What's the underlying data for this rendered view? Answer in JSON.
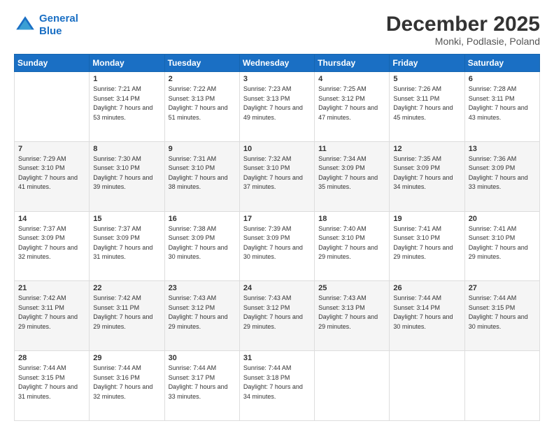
{
  "logo": {
    "line1": "General",
    "line2": "Blue"
  },
  "header": {
    "month": "December 2025",
    "location": "Monki, Podlasie, Poland"
  },
  "days_of_week": [
    "Sunday",
    "Monday",
    "Tuesday",
    "Wednesday",
    "Thursday",
    "Friday",
    "Saturday"
  ],
  "weeks": [
    [
      {
        "day": "",
        "sunrise": "",
        "sunset": "",
        "daylight": ""
      },
      {
        "day": "1",
        "sunrise": "Sunrise: 7:21 AM",
        "sunset": "Sunset: 3:14 PM",
        "daylight": "Daylight: 7 hours and 53 minutes."
      },
      {
        "day": "2",
        "sunrise": "Sunrise: 7:22 AM",
        "sunset": "Sunset: 3:13 PM",
        "daylight": "Daylight: 7 hours and 51 minutes."
      },
      {
        "day": "3",
        "sunrise": "Sunrise: 7:23 AM",
        "sunset": "Sunset: 3:13 PM",
        "daylight": "Daylight: 7 hours and 49 minutes."
      },
      {
        "day": "4",
        "sunrise": "Sunrise: 7:25 AM",
        "sunset": "Sunset: 3:12 PM",
        "daylight": "Daylight: 7 hours and 47 minutes."
      },
      {
        "day": "5",
        "sunrise": "Sunrise: 7:26 AM",
        "sunset": "Sunset: 3:11 PM",
        "daylight": "Daylight: 7 hours and 45 minutes."
      },
      {
        "day": "6",
        "sunrise": "Sunrise: 7:28 AM",
        "sunset": "Sunset: 3:11 PM",
        "daylight": "Daylight: 7 hours and 43 minutes."
      }
    ],
    [
      {
        "day": "7",
        "sunrise": "Sunrise: 7:29 AM",
        "sunset": "Sunset: 3:10 PM",
        "daylight": "Daylight: 7 hours and 41 minutes."
      },
      {
        "day": "8",
        "sunrise": "Sunrise: 7:30 AM",
        "sunset": "Sunset: 3:10 PM",
        "daylight": "Daylight: 7 hours and 39 minutes."
      },
      {
        "day": "9",
        "sunrise": "Sunrise: 7:31 AM",
        "sunset": "Sunset: 3:10 PM",
        "daylight": "Daylight: 7 hours and 38 minutes."
      },
      {
        "day": "10",
        "sunrise": "Sunrise: 7:32 AM",
        "sunset": "Sunset: 3:10 PM",
        "daylight": "Daylight: 7 hours and 37 minutes."
      },
      {
        "day": "11",
        "sunrise": "Sunrise: 7:34 AM",
        "sunset": "Sunset: 3:09 PM",
        "daylight": "Daylight: 7 hours and 35 minutes."
      },
      {
        "day": "12",
        "sunrise": "Sunrise: 7:35 AM",
        "sunset": "Sunset: 3:09 PM",
        "daylight": "Daylight: 7 hours and 34 minutes."
      },
      {
        "day": "13",
        "sunrise": "Sunrise: 7:36 AM",
        "sunset": "Sunset: 3:09 PM",
        "daylight": "Daylight: 7 hours and 33 minutes."
      }
    ],
    [
      {
        "day": "14",
        "sunrise": "Sunrise: 7:37 AM",
        "sunset": "Sunset: 3:09 PM",
        "daylight": "Daylight: 7 hours and 32 minutes."
      },
      {
        "day": "15",
        "sunrise": "Sunrise: 7:37 AM",
        "sunset": "Sunset: 3:09 PM",
        "daylight": "Daylight: 7 hours and 31 minutes."
      },
      {
        "day": "16",
        "sunrise": "Sunrise: 7:38 AM",
        "sunset": "Sunset: 3:09 PM",
        "daylight": "Daylight: 7 hours and 30 minutes."
      },
      {
        "day": "17",
        "sunrise": "Sunrise: 7:39 AM",
        "sunset": "Sunset: 3:09 PM",
        "daylight": "Daylight: 7 hours and 30 minutes."
      },
      {
        "day": "18",
        "sunrise": "Sunrise: 7:40 AM",
        "sunset": "Sunset: 3:10 PM",
        "daylight": "Daylight: 7 hours and 29 minutes."
      },
      {
        "day": "19",
        "sunrise": "Sunrise: 7:41 AM",
        "sunset": "Sunset: 3:10 PM",
        "daylight": "Daylight: 7 hours and 29 minutes."
      },
      {
        "day": "20",
        "sunrise": "Sunrise: 7:41 AM",
        "sunset": "Sunset: 3:10 PM",
        "daylight": "Daylight: 7 hours and 29 minutes."
      }
    ],
    [
      {
        "day": "21",
        "sunrise": "Sunrise: 7:42 AM",
        "sunset": "Sunset: 3:11 PM",
        "daylight": "Daylight: 7 hours and 29 minutes."
      },
      {
        "day": "22",
        "sunrise": "Sunrise: 7:42 AM",
        "sunset": "Sunset: 3:11 PM",
        "daylight": "Daylight: 7 hours and 29 minutes."
      },
      {
        "day": "23",
        "sunrise": "Sunrise: 7:43 AM",
        "sunset": "Sunset: 3:12 PM",
        "daylight": "Daylight: 7 hours and 29 minutes."
      },
      {
        "day": "24",
        "sunrise": "Sunrise: 7:43 AM",
        "sunset": "Sunset: 3:12 PM",
        "daylight": "Daylight: 7 hours and 29 minutes."
      },
      {
        "day": "25",
        "sunrise": "Sunrise: 7:43 AM",
        "sunset": "Sunset: 3:13 PM",
        "daylight": "Daylight: 7 hours and 29 minutes."
      },
      {
        "day": "26",
        "sunrise": "Sunrise: 7:44 AM",
        "sunset": "Sunset: 3:14 PM",
        "daylight": "Daylight: 7 hours and 30 minutes."
      },
      {
        "day": "27",
        "sunrise": "Sunrise: 7:44 AM",
        "sunset": "Sunset: 3:15 PM",
        "daylight": "Daylight: 7 hours and 30 minutes."
      }
    ],
    [
      {
        "day": "28",
        "sunrise": "Sunrise: 7:44 AM",
        "sunset": "Sunset: 3:15 PM",
        "daylight": "Daylight: 7 hours and 31 minutes."
      },
      {
        "day": "29",
        "sunrise": "Sunrise: 7:44 AM",
        "sunset": "Sunset: 3:16 PM",
        "daylight": "Daylight: 7 hours and 32 minutes."
      },
      {
        "day": "30",
        "sunrise": "Sunrise: 7:44 AM",
        "sunset": "Sunset: 3:17 PM",
        "daylight": "Daylight: 7 hours and 33 minutes."
      },
      {
        "day": "31",
        "sunrise": "Sunrise: 7:44 AM",
        "sunset": "Sunset: 3:18 PM",
        "daylight": "Daylight: 7 hours and 34 minutes."
      },
      {
        "day": "",
        "sunrise": "",
        "sunset": "",
        "daylight": ""
      },
      {
        "day": "",
        "sunrise": "",
        "sunset": "",
        "daylight": ""
      },
      {
        "day": "",
        "sunrise": "",
        "sunset": "",
        "daylight": ""
      }
    ]
  ]
}
